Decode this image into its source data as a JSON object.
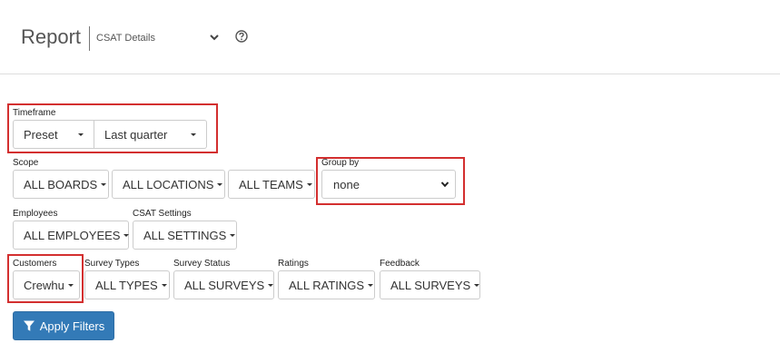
{
  "header": {
    "title": "Report",
    "report_select": "CSAT Details"
  },
  "filters": {
    "timeframe": {
      "label": "Timeframe",
      "mode": "Preset",
      "period": "Last quarter"
    },
    "scope": {
      "label": "Scope",
      "boards": "ALL BOARDS",
      "locations": "ALL LOCATIONS",
      "teams": "ALL TEAMS"
    },
    "group_by": {
      "label": "Group by",
      "value": "none"
    },
    "employees": {
      "label": "Employees",
      "value": "ALL EMPLOYEES"
    },
    "csat_settings": {
      "label": "CSAT Settings",
      "value": "ALL SETTINGS"
    },
    "customers": {
      "label": "Customers",
      "value": "Crewhu"
    },
    "survey_types": {
      "label": "Survey Types",
      "value": "ALL TYPES"
    },
    "survey_status": {
      "label": "Survey Status",
      "value": "ALL SURVEYS"
    },
    "ratings": {
      "label": "Ratings",
      "value": "ALL RATINGS"
    },
    "feedback": {
      "label": "Feedback",
      "value": "ALL SURVEYS"
    }
  },
  "actions": {
    "apply_label": "Apply Filters"
  },
  "colors": {
    "highlight": "#d32f2f",
    "primary": "#337ab7"
  }
}
